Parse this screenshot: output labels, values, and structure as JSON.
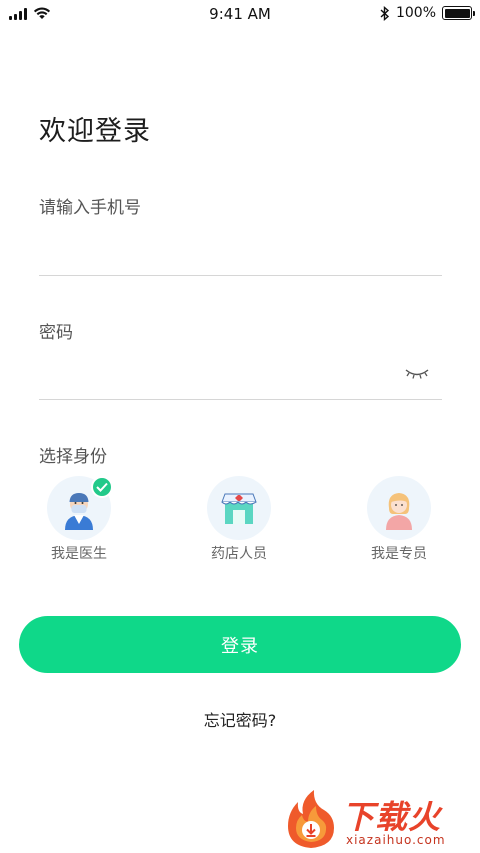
{
  "status_bar": {
    "time": "9:41 AM",
    "battery": "100%",
    "battery_level": 1.0,
    "icons": [
      "signal-icon",
      "wifi-icon",
      "bluetooth-icon",
      "battery-icon"
    ]
  },
  "login": {
    "title": "欢迎登录",
    "phone_label": "请输入手机号",
    "phone_value": "",
    "password_label": "密码",
    "password_value": "",
    "password_toggle_icon": "eye-closed-icon"
  },
  "identity": {
    "label": "选择身份",
    "selected": "doctor",
    "roles": [
      {
        "id": "doctor",
        "label": "我是医生",
        "icon": "doctor-icon"
      },
      {
        "id": "pharmacy",
        "label": "药店人员",
        "icon": "pharmacy-icon"
      },
      {
        "id": "specialist",
        "label": "我是专员",
        "icon": "specialist-icon"
      }
    ]
  },
  "actions": {
    "login_button": "登录",
    "forgot_password": "忘记密码?"
  },
  "watermark": {
    "text": "下载火",
    "subtext": "xiazaihuo.com"
  },
  "colors": {
    "accent": "#0fd889",
    "check": "#22c98a",
    "avatar_bg": "#eef5fb",
    "watermark": "#e8432a"
  }
}
